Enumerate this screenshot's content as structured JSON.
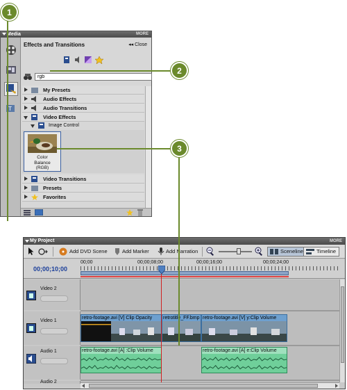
{
  "callouts": {
    "one": "1",
    "two": "2",
    "three": "3"
  },
  "media_panel": {
    "title": "Media",
    "more": "MORE",
    "effects_title": "Effects and Transitions",
    "close": "Close",
    "search_value": "rgb",
    "categories": [
      {
        "label": "My Presets"
      },
      {
        "label": "Audio Effects"
      },
      {
        "label": "Audio Transitions"
      },
      {
        "label": "Video Effects"
      }
    ],
    "subcategory": "Image Control",
    "effect": {
      "line1": "Color",
      "line2": "Balance",
      "line3": "(RGB)"
    },
    "categories_after": [
      {
        "label": "Video Transitions"
      },
      {
        "label": "Presets"
      },
      {
        "label": "Favorites"
      }
    ]
  },
  "project": {
    "title": "My Project",
    "more": "MORE",
    "toolbar": {
      "add_dvd": "Add DVD Scene",
      "add_marker": "Add Marker",
      "add_narration": "Add Narration",
      "sceneline": "Sceneline",
      "timeline": "Timeline"
    },
    "timecode": "00;00;10;00",
    "ruler_ticks": [
      "00;00",
      "00;00;08;00",
      "00;00;16;00",
      "00;00;24;00"
    ],
    "tracks": {
      "video2": "Video 2",
      "video1": "Video 1",
      "audio1": "Audio 1",
      "audio2": "Audio 2"
    },
    "video_clips": [
      {
        "label": "retro-footage.avi [V]  Clip Opacity"
      },
      {
        "label": "retrotitle_FF.bmp"
      },
      {
        "label": "retro-footage.avi [V]  y:Clip Volume"
      }
    ],
    "audio_clips": [
      {
        "label": "retro-footage.avi [A]  :Clip Volume"
      },
      {
        "label": "retro-footage.avi [A]  e:Clip Volume"
      }
    ]
  },
  "colors": {
    "callout": "#6b8a2c",
    "playhead": "#d02020",
    "selected_tool": "#e8e8e8"
  }
}
